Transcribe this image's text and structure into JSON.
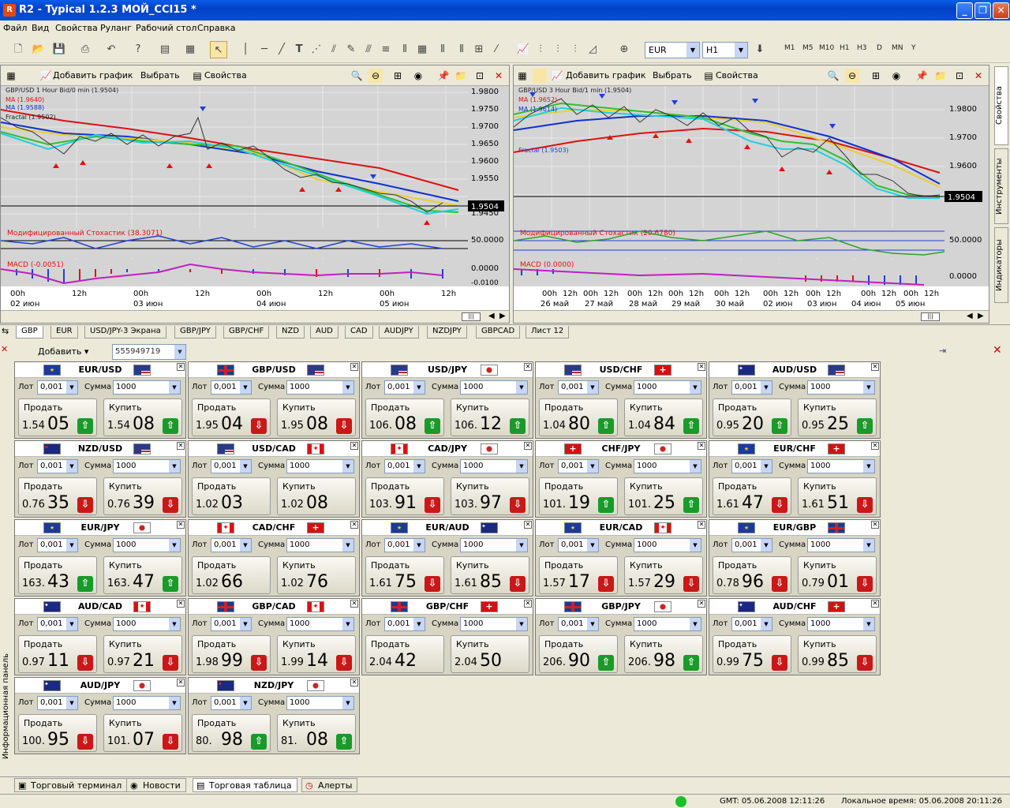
{
  "window": {
    "title": "R2 - Typical 1.2.3 МОЙ_CCI15 *"
  },
  "menu": [
    "Файл",
    "Вид",
    "Свойства",
    "Руланг",
    "Рабочий стол",
    "Справка"
  ],
  "toolbar": {
    "symbol": "EUR",
    "timeframe": "H1",
    "periods": [
      "M1",
      "M5",
      "M10",
      "H1",
      "H3",
      "D",
      "MN",
      "Y"
    ]
  },
  "chart_toolbar": {
    "add_chart": "Добавить график",
    "select": "Выбрать",
    "properties": "Свойства"
  },
  "charts": [
    {
      "price_scale": [
        "1.9800",
        "1.9750",
        "1.9700",
        "1.9650",
        "1.9600",
        "1.9550",
        "1.9504",
        "1.9450"
      ],
      "current": "1.9504",
      "osc1_label": "Модифицированный Стохастик (38.3071)",
      "osc1_level": "50.0000",
      "osc2_label": "MACD (-0.0051)",
      "osc2_levels": [
        "0.0000",
        "-0.0100"
      ],
      "time_labels": [
        "00h",
        "12h",
        "00h",
        "12h",
        "00h",
        "12h",
        "00h",
        "12h"
      ],
      "date_labels": [
        "02 июн",
        "03 июн",
        "04 июн",
        "05 июн"
      ]
    },
    {
      "price_scale": [
        "1.9800",
        "1.9700",
        "1.9600",
        "1.9504"
      ],
      "current": "1.9504",
      "fractal": "Fractal (1.9503)",
      "osc1_label": "Модифицированный Стохастик (20.6780)",
      "osc1_level": "50.0000",
      "osc2_label": "MACD (0.0000)",
      "osc2_levels": [
        "0.0000"
      ],
      "time_labels": [
        "00h",
        "12h",
        "00h",
        "12h",
        "00h",
        "12h",
        "00h",
        "12h",
        "00h",
        "12h",
        "00h",
        "12h",
        "00h",
        "12h",
        "00h",
        "12h",
        "00h",
        "12h"
      ],
      "date_labels": [
        "26 май",
        "27 май",
        "28 май",
        "29 май",
        "30 май",
        "02 июн",
        "03 июн",
        "04 июн",
        "05 июн"
      ]
    }
  ],
  "tabs": [
    "GBP",
    "EUR",
    "USD/JPY-3 Экрана",
    "GBP/JPY",
    "GBP/CHF",
    "NZD",
    "AUD",
    "CAD",
    "AUDJPY",
    "NZDJPY",
    "GBPCAD",
    "Лист 12"
  ],
  "side_tabs": [
    "Свойства",
    "Инструменты",
    "Индикаторы"
  ],
  "panel": {
    "add": "Добавить",
    "combo": "555949719"
  },
  "labels": {
    "lot": "Лот",
    "sum": "Сумма",
    "sell": "Продать",
    "buy": "Купить",
    "lot_val": "0,001",
    "sum_val": "1000"
  },
  "pairs": [
    {
      "name": "EUR/USD",
      "f1": "eu",
      "f2": "us",
      "sell_s": "1.54",
      "sell_b": "05",
      "sell_dir": "up",
      "buy_s": "1.54",
      "buy_b": "08",
      "buy_dir": "up"
    },
    {
      "name": "GBP/USD",
      "f1": "gb",
      "f2": "us",
      "sell_s": "1.95",
      "sell_b": "04",
      "sell_dir": "down",
      "buy_s": "1.95",
      "buy_b": "08",
      "buy_dir": "down"
    },
    {
      "name": "USD/JPY",
      "f1": "us",
      "f2": "jp",
      "sell_s": "106.",
      "sell_b": "08",
      "sell_dir": "up",
      "buy_s": "106.",
      "buy_b": "12",
      "buy_dir": "up"
    },
    {
      "name": "USD/CHF",
      "f1": "us",
      "f2": "ch",
      "sell_s": "1.04",
      "sell_b": "80",
      "sell_dir": "up",
      "buy_s": "1.04",
      "buy_b": "84",
      "buy_dir": "up"
    },
    {
      "name": "AUD/USD",
      "f1": "au",
      "f2": "us",
      "sell_s": "0.95",
      "sell_b": "20",
      "sell_dir": "up",
      "buy_s": "0.95",
      "buy_b": "25",
      "buy_dir": "up"
    },
    {
      "name": "NZD/USD",
      "f1": "nz",
      "f2": "us",
      "sell_s": "0.76",
      "sell_b": "35",
      "sell_dir": "down",
      "buy_s": "0.76",
      "buy_b": "39",
      "buy_dir": "down"
    },
    {
      "name": "USD/CAD",
      "f1": "us",
      "f2": "ca",
      "sell_s": "1.02",
      "sell_b": "03",
      "sell_dir": "",
      "buy_s": "1.02",
      "buy_b": "08",
      "buy_dir": ""
    },
    {
      "name": "CAD/JPY",
      "f1": "ca",
      "f2": "jp",
      "sell_s": "103.",
      "sell_b": "91",
      "sell_dir": "down",
      "buy_s": "103.",
      "buy_b": "97",
      "buy_dir": "down"
    },
    {
      "name": "CHF/JPY",
      "f1": "ch",
      "f2": "jp",
      "sell_s": "101.",
      "sell_b": "19",
      "sell_dir": "up",
      "buy_s": "101.",
      "buy_b": "25",
      "buy_dir": "up"
    },
    {
      "name": "EUR/CHF",
      "f1": "eu",
      "f2": "ch",
      "sell_s": "1.61",
      "sell_b": "47",
      "sell_dir": "down",
      "buy_s": "1.61",
      "buy_b": "51",
      "buy_dir": "down"
    },
    {
      "name": "EUR/JPY",
      "f1": "eu",
      "f2": "jp",
      "sell_s": "163.",
      "sell_b": "43",
      "sell_dir": "up",
      "buy_s": "163.",
      "buy_b": "47",
      "buy_dir": "up"
    },
    {
      "name": "CAD/CHF",
      "f1": "ca",
      "f2": "ch",
      "sell_s": "1.02",
      "sell_b": "66",
      "sell_dir": "",
      "buy_s": "1.02",
      "buy_b": "76",
      "buy_dir": ""
    },
    {
      "name": "EUR/AUD",
      "f1": "eu",
      "f2": "au",
      "sell_s": "1.61",
      "sell_b": "75",
      "sell_dir": "down",
      "buy_s": "1.61",
      "buy_b": "85",
      "buy_dir": "down"
    },
    {
      "name": "EUR/CAD",
      "f1": "eu",
      "f2": "ca",
      "sell_s": "1.57",
      "sell_b": "17",
      "sell_dir": "down",
      "buy_s": "1.57",
      "buy_b": "29",
      "buy_dir": "down"
    },
    {
      "name": "EUR/GBP",
      "f1": "eu",
      "f2": "gb",
      "sell_s": "0.78",
      "sell_b": "96",
      "sell_dir": "down",
      "buy_s": "0.79",
      "buy_b": "01",
      "buy_dir": "down"
    },
    {
      "name": "AUD/CAD",
      "f1": "au",
      "f2": "ca",
      "sell_s": "0.97",
      "sell_b": "11",
      "sell_dir": "down",
      "buy_s": "0.97",
      "buy_b": "21",
      "buy_dir": "down"
    },
    {
      "name": "GBP/CAD",
      "f1": "gb",
      "f2": "ca",
      "sell_s": "1.98",
      "sell_b": "99",
      "sell_dir": "down",
      "buy_s": "1.99",
      "buy_b": "14",
      "buy_dir": "down"
    },
    {
      "name": "GBP/CHF",
      "f1": "gb",
      "f2": "ch",
      "sell_s": "2.04",
      "sell_b": "42",
      "sell_dir": "",
      "buy_s": "2.04",
      "buy_b": "50",
      "buy_dir": ""
    },
    {
      "name": "GBP/JPY",
      "f1": "gb",
      "f2": "jp",
      "sell_s": "206.",
      "sell_b": "90",
      "sell_dir": "up",
      "buy_s": "206.",
      "buy_b": "98",
      "buy_dir": "up"
    },
    {
      "name": "AUD/CHF",
      "f1": "au",
      "f2": "ch",
      "sell_s": "0.99",
      "sell_b": "75",
      "sell_dir": "down",
      "buy_s": "0.99",
      "buy_b": "85",
      "buy_dir": "down"
    },
    {
      "name": "AUD/JPY",
      "f1": "au",
      "f2": "jp",
      "sell_s": "100.",
      "sell_b": "95",
      "sell_dir": "down",
      "buy_s": "101.",
      "buy_b": "07",
      "buy_dir": "down"
    },
    {
      "name": "NZD/JPY",
      "f1": "nz",
      "f2": "jp",
      "sell_s": "80.",
      "sell_b": "98",
      "sell_dir": "up",
      "buy_s": "81.",
      "buy_b": "08",
      "buy_dir": "up"
    }
  ],
  "left_strip": "Информационная панель",
  "bottom_tabs": [
    "Торговый терминал",
    "Новости",
    "Торговая таблица",
    "Алерты"
  ],
  "status": {
    "gmt": "GMT: 05.06.2008 12:11:26",
    "local": "Локальное время: 05.06.2008 20:11:26"
  },
  "colors": {
    "up": "#1a9a2a",
    "down": "#c81818"
  }
}
